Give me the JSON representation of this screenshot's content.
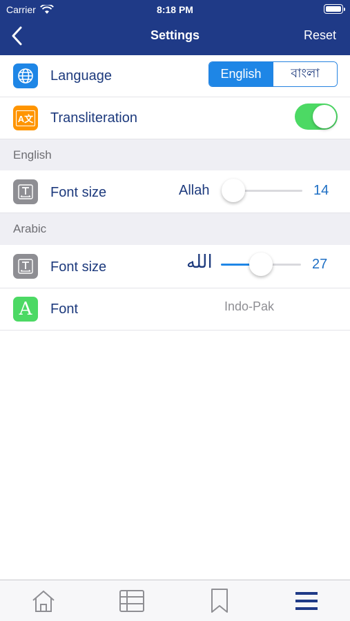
{
  "status_bar": {
    "carrier": "Carrier",
    "time": "8:18 PM"
  },
  "navbar": {
    "title": "Settings",
    "reset_label": "Reset"
  },
  "language_row": {
    "label": "Language",
    "options": [
      "English",
      "বাংলা"
    ],
    "selected": "English"
  },
  "transliteration_row": {
    "label": "Transliteration",
    "enabled": true
  },
  "section_english": {
    "header": "English"
  },
  "english_font_row": {
    "label": "Font size",
    "preview": "Allah",
    "value": "14",
    "slider_fraction": 0.14
  },
  "section_arabic": {
    "header": "Arabic"
  },
  "arabic_font_row": {
    "label": "Font size",
    "preview": "الله",
    "value": "27",
    "slider_fraction": 0.5
  },
  "font_row": {
    "label": "Font",
    "icon_letter": "A",
    "value": "Indo-Pak"
  },
  "transliteration_icon_text": "A文",
  "colors": {
    "header": "#1f3a87",
    "accent": "#1e86e6",
    "toggle_on": "#4cd964",
    "icon_blue": "#1e86e6",
    "icon_orange": "#ff9500",
    "icon_gray": "#8e8e93",
    "icon_green": "#4cd964"
  },
  "tabbar": {
    "tabs": [
      "home-icon",
      "list-icon",
      "bookmark-icon",
      "menu-icon"
    ]
  }
}
